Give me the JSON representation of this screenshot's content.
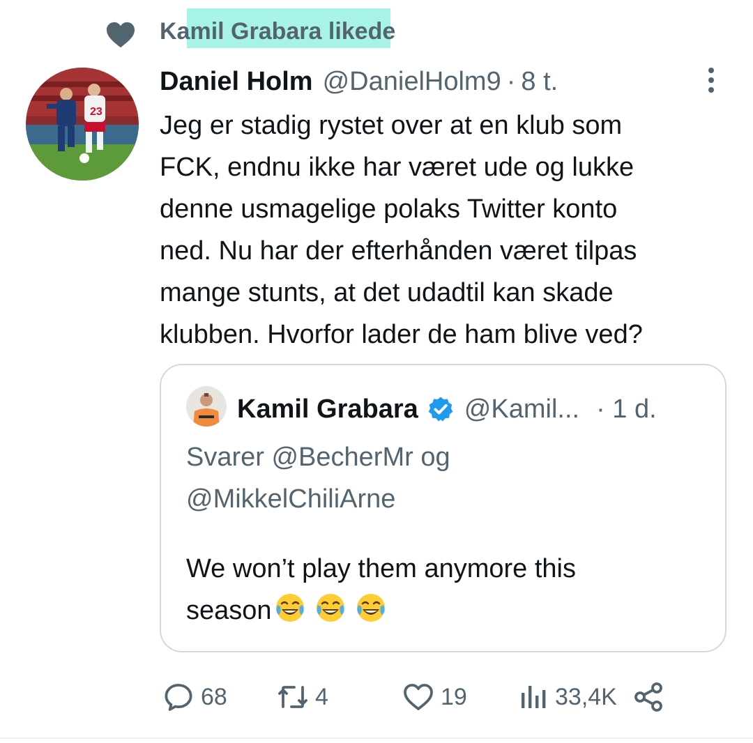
{
  "social_context": {
    "text": "Kamil Grabara likede",
    "icon": "heart-icon"
  },
  "tweet": {
    "author_name": "Daniel Holm",
    "author_handle": "@DanielHolm9",
    "separator": "·",
    "time": "8 t.",
    "text": "Jeg er stadig rystet over at en klub som\nFCK, endnu ikke har været ude og lukke\ndenne usmagelige polaks Twitter konto\nned. Nu har der efterhånden været tilpas\nmange stunts, at det udadtil kan skade\nklubben. Hvorfor lader de ham blive ved?"
  },
  "quote": {
    "author_name": "Kamil Grabara",
    "author_handle": "@Kamil...",
    "time": "· 1 d.",
    "reply_prefix": "Svarer",
    "reply_mention_1": "@BecherMr",
    "reply_joiner": "og",
    "reply_mention_2": "@MikkelChiliArne",
    "text": "We won’t play them anymore this\nseason",
    "emojis": [
      "face-with-tears-of-joy",
      "face-with-tears-of-joy",
      "face-with-tears-of-joy"
    ]
  },
  "actions": {
    "replies": "68",
    "retweets": "4",
    "likes": "19",
    "views": "33,4K"
  },
  "colors": {
    "primary_text": "#0f1419",
    "secondary_text": "#536471",
    "border": "#cfd9de",
    "verified": "#1d9bf0",
    "highlight": "#9ef2e6"
  }
}
